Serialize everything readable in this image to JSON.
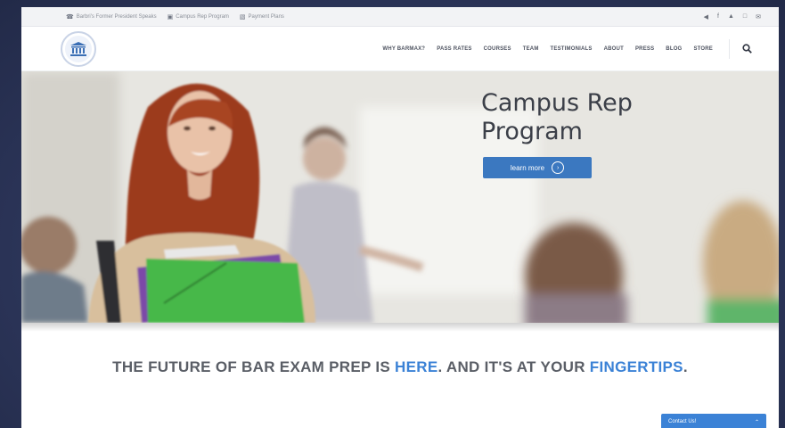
{
  "topbar": {
    "links": [
      {
        "icon": "megaphone-icon",
        "label": "Barbri's Former President Speaks"
      },
      {
        "icon": "graduation-cap-icon",
        "label": "Campus Rep Program"
      },
      {
        "icon": "money-icon",
        "label": "Payment Plans"
      }
    ],
    "social": [
      "twitter-icon",
      "facebook-icon",
      "youtube-icon",
      "instagram-icon",
      "email-icon"
    ]
  },
  "nav": {
    "logo": "courthouse-logo",
    "items": [
      "WHY BARMAX?",
      "PASS RATES",
      "COURSES",
      "TEAM",
      "TESTIMONIALS",
      "ABOUT",
      "PRESS",
      "BLOG",
      "STORE"
    ]
  },
  "hero": {
    "title_line1": "Campus Rep",
    "title_line2": "Program",
    "button_label": "learn more"
  },
  "tagline": {
    "part1": "THE FUTURE OF BAR EXAM PREP IS ",
    "highlight1": "HERE",
    "part2": ". AND IT'S AT YOUR ",
    "highlight2": "FINGERTIPS",
    "part3": "."
  },
  "contact": {
    "label": "Contact Us!"
  },
  "colors": {
    "accent": "#3b82d6",
    "button": "#3b78c0",
    "text": "#5a5e66"
  }
}
